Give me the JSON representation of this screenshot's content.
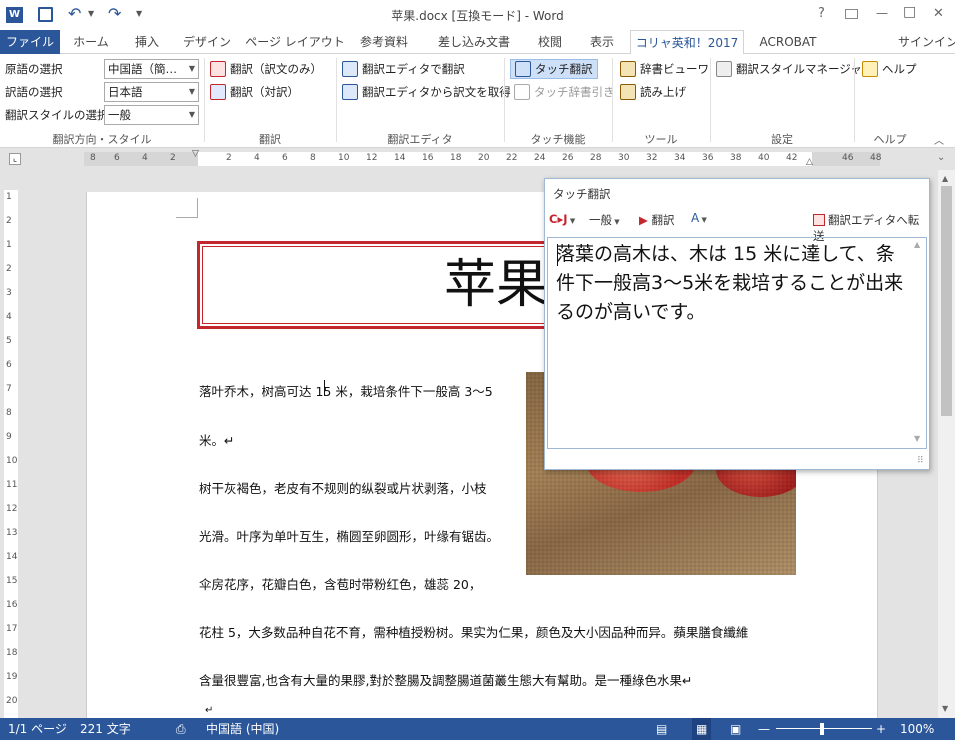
{
  "titlebar": {
    "doc_title": "苹果.docx [互換モード] - Word",
    "help": "?",
    "min": "—",
    "max": "□",
    "close": "✕"
  },
  "tabs": [
    {
      "label": "ファイル"
    },
    {
      "label": "ホーム"
    },
    {
      "label": "挿入"
    },
    {
      "label": "デザイン"
    },
    {
      "label": "ページ レイアウト"
    },
    {
      "label": "参考資料"
    },
    {
      "label": "差し込み文書"
    },
    {
      "label": "校閲"
    },
    {
      "label": "表示"
    },
    {
      "label": "コリャ英和！2017"
    },
    {
      "label": "ACROBAT"
    }
  ],
  "signin": "サインイン",
  "ribbon": {
    "dir": {
      "src_label": "原語の選択",
      "src_value": "中国語（簡…",
      "tgt_label": "訳語の選択",
      "tgt_value": "日本語",
      "style_label": "翻訳スタイルの選択",
      "style_value": "一般",
      "group": "翻訳方向・スタイル"
    },
    "translate": {
      "b1": "翻訳（訳文のみ）",
      "b2": "翻訳（対訳）",
      "group": "翻訳"
    },
    "editor": {
      "b1": "翻訳エディタで翻訳",
      "b2": "翻訳エディタから訳文を取得",
      "group": "翻訳エディタ"
    },
    "touch": {
      "b1": "タッチ翻訳",
      "b2": "タッチ辞書引き",
      "group": "タッチ機能"
    },
    "tools": {
      "b1": "辞書ビューワ",
      "b2": "読み上げ",
      "group": "ツール"
    },
    "settings": {
      "b1": "翻訳スタイルマネージャ",
      "group": "設定"
    },
    "help": {
      "b1": "ヘルプ",
      "group": "ヘルプ"
    }
  },
  "ruler": {
    "h_ticks": [
      "8",
      "6",
      "4",
      "2",
      "2",
      "4",
      "6",
      "8",
      "10",
      "12",
      "14",
      "16",
      "18",
      "20",
      "22",
      "24",
      "26",
      "28",
      "30",
      "32",
      "34",
      "36",
      "38",
      "40",
      "42",
      "46",
      "48"
    ],
    "v_ticks": [
      "1",
      "2",
      "1",
      "2",
      "3",
      "4",
      "5",
      "6",
      "7",
      "8",
      "9",
      "10",
      "11",
      "12",
      "13",
      "14",
      "15",
      "16",
      "17",
      "18",
      "19",
      "20"
    ]
  },
  "doc": {
    "title": "苹果",
    "lines": [
      "落叶乔木，树高可达 15 米，栽培条件下一般高 3～5",
      "米。↵",
      "树干灰褐色，老皮有不规则的纵裂或片状剥落，小枝",
      "光滑。叶序为单叶互生，椭圆至卵圆形，叶缘有锯齿。",
      "伞房花序，花瓣白色，含苞时带粉红色，雄蕊 20，",
      "花柱 5，大多数品种自花不育，需种植授粉树。果实为仁果，颜色及大小因品种而异。蘋果膳食纖維",
      "含量很豐富,也含有大量的果膠,對於整腸及調整腸道菌叢生態大有幫助。是一種綠色水果↵",
      "↵"
    ]
  },
  "popup": {
    "title": "タッチ翻訳",
    "lang": "C▸J",
    "style": "一般",
    "translate": "翻訳",
    "send": "翻訳エディタへ転送",
    "result": "落葉の高木は、木は 15 米に達して、条件下一般高3～5米を栽培することが出来るのが高いです。"
  },
  "status": {
    "page": "1/1 ページ",
    "words": "221 文字",
    "lang": "中国語 (中国)",
    "zoom": "100%"
  },
  "colors": {
    "accent": "#2b579a",
    "title_border": "#c4262e"
  }
}
